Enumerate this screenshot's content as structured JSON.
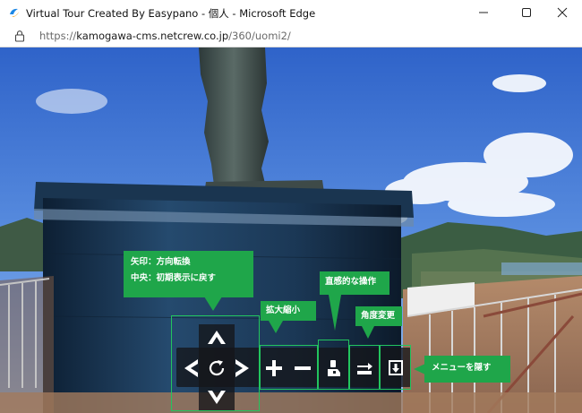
{
  "window": {
    "title": "Virtual Tour Created By Easypano - 個人 - Microsoft Edge",
    "minimize_icon": "minimize-icon",
    "maximize_icon": "maximize-icon",
    "close_icon": "close-icon"
  },
  "address_bar": {
    "scheme": "https://",
    "host": "kamogawa-cms.netcrew.co.jp",
    "path": "/360/uomi2/",
    "lock_icon": "lock-icon"
  },
  "tour_controls": {
    "callouts": {
      "arrows_line1": "矢印：方向転換",
      "arrows_line2": "中央：初期表示に戻す",
      "zoom": "拡大縮小",
      "gyro": "直感的な操作",
      "angle": "角度変更",
      "hide_menu": "メニューを隠す"
    },
    "buttons": [
      {
        "name": "pan-up-button",
        "icon": "arrow-up-icon"
      },
      {
        "name": "pan-left-button",
        "icon": "arrow-left-icon"
      },
      {
        "name": "reset-view-button",
        "icon": "rotate-reset-icon"
      },
      {
        "name": "pan-right-button",
        "icon": "arrow-right-icon"
      },
      {
        "name": "pan-down-button",
        "icon": "arrow-down-icon"
      },
      {
        "name": "zoom-in-button",
        "icon": "plus-icon"
      },
      {
        "name": "zoom-out-button",
        "icon": "minus-icon"
      },
      {
        "name": "gyro-button",
        "icon": "gyroscope-icon"
      },
      {
        "name": "angle-change-button",
        "icon": "swap-arrows-icon"
      },
      {
        "name": "hide-menu-button",
        "icon": "hide-down-icon"
      }
    ],
    "callout_color": "#1fa64a",
    "highlight_color": "#22c55e"
  }
}
